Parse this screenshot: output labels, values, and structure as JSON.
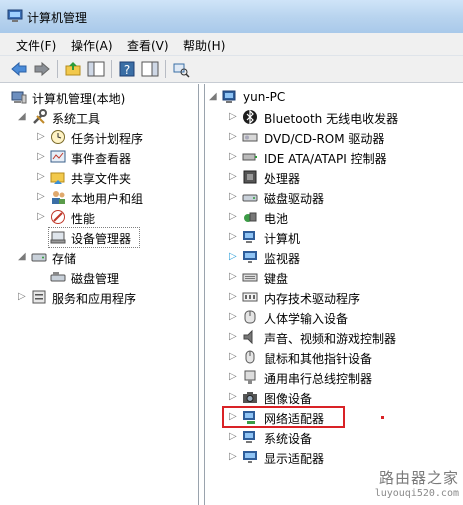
{
  "window": {
    "title": "计算机管理"
  },
  "menu": [
    {
      "label": "文件(F)"
    },
    {
      "label": "操作(A)"
    },
    {
      "label": "查看(V)"
    },
    {
      "label": "帮助(H)"
    }
  ],
  "toolbar": {
    "buttons": [
      "back-arrow-icon",
      "forward-arrow-icon",
      "up-folder-icon",
      "show-hide-tree-icon",
      "help-icon",
      "action-pane-icon",
      "device-scan-icon"
    ]
  },
  "left_tree": [
    {
      "label": "计算机管理(本地)",
      "icon": "computer-management-icon",
      "level": 0,
      "arrow": ""
    },
    {
      "label": "系统工具",
      "icon": "tools-icon",
      "level": 1,
      "arrow": "expanded"
    },
    {
      "label": "任务计划程序",
      "icon": "clock-icon",
      "level": 2,
      "arrow": "collapsed"
    },
    {
      "label": "事件查看器",
      "icon": "event-viewer-icon",
      "level": 2,
      "arrow": "collapsed"
    },
    {
      "label": "共享文件夹",
      "icon": "shared-folder-icon",
      "level": 2,
      "arrow": "collapsed"
    },
    {
      "label": "本地用户和组",
      "icon": "users-icon",
      "level": 2,
      "arrow": "collapsed"
    },
    {
      "label": "性能",
      "icon": "performance-icon",
      "level": 2,
      "arrow": "collapsed"
    },
    {
      "label": "设备管理器",
      "icon": "device-manager-icon",
      "level": 2,
      "arrow": "",
      "selected": true
    },
    {
      "label": "存储",
      "icon": "storage-icon",
      "level": 1,
      "arrow": "expanded"
    },
    {
      "label": "磁盘管理",
      "icon": "disk-management-icon",
      "level": 2,
      "arrow": ""
    },
    {
      "label": "服务和应用程序",
      "icon": "services-icon",
      "level": 1,
      "arrow": "collapsed"
    }
  ],
  "right_tree": {
    "root": {
      "label": "yun-PC",
      "icon": "computer-icon"
    },
    "items": [
      {
        "label": "Bluetooth 无线电收发器",
        "icon": "bluetooth-icon"
      },
      {
        "label": "DVD/CD-ROM 驱动器",
        "icon": "dvd-drive-icon"
      },
      {
        "label": "IDE ATA/ATAPI 控制器",
        "icon": "ide-controller-icon"
      },
      {
        "label": "处理器",
        "icon": "processor-icon"
      },
      {
        "label": "磁盘驱动器",
        "icon": "disk-drive-icon"
      },
      {
        "label": "电池",
        "icon": "battery-icon"
      },
      {
        "label": "计算机",
        "icon": "computer-icon"
      },
      {
        "label": "监视器",
        "icon": "monitor-icon"
      },
      {
        "label": "键盘",
        "icon": "keyboard-icon"
      },
      {
        "label": "内存技术驱动程序",
        "icon": "memory-icon"
      },
      {
        "label": "人体学输入设备",
        "icon": "hid-icon"
      },
      {
        "label": "声音、视频和游戏控制器",
        "icon": "sound-icon"
      },
      {
        "label": "鼠标和其他指针设备",
        "icon": "mouse-icon"
      },
      {
        "label": "通用串行总线控制器",
        "icon": "usb-icon"
      },
      {
        "label": "图像设备",
        "icon": "camera-icon"
      },
      {
        "label": "网络适配器",
        "icon": "network-adapter-icon",
        "highlighted": true
      },
      {
        "label": "系统设备",
        "icon": "system-devices-icon"
      },
      {
        "label": "显示适配器",
        "icon": "display-adapter-icon"
      }
    ]
  },
  "watermark": {
    "text": "路由器之家",
    "url": "luyouqi520.com"
  },
  "colors": {
    "highlight": "#d92226",
    "accent": "#3a6ea5"
  }
}
